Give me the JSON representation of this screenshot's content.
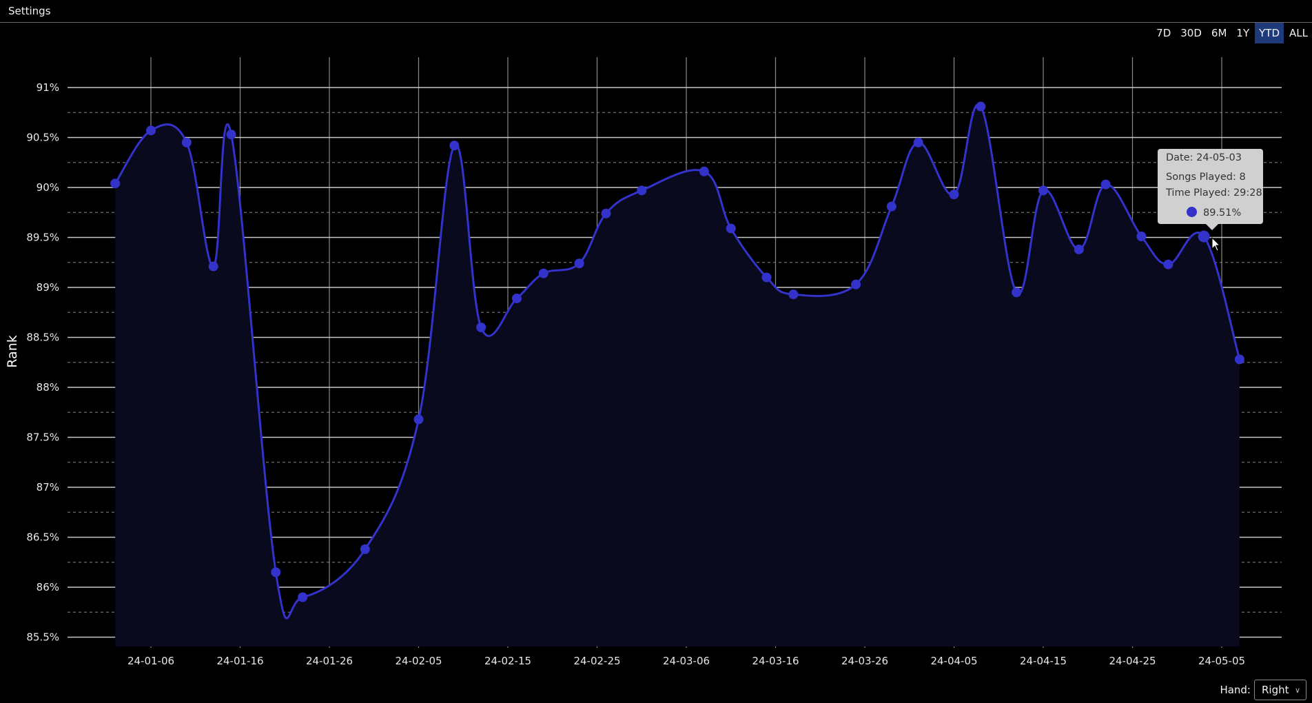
{
  "menu": {
    "settings_label": "Settings"
  },
  "range_buttons": [
    {
      "label": "7D",
      "active": false
    },
    {
      "label": "30D",
      "active": false
    },
    {
      "label": "6M",
      "active": false
    },
    {
      "label": "1Y",
      "active": false
    },
    {
      "label": "YTD",
      "active": true
    },
    {
      "label": "ALL",
      "active": false
    }
  ],
  "hand": {
    "label": "Hand:",
    "value": "Right"
  },
  "colors": {
    "series": "#3333cc",
    "fill": "#0a0a1e",
    "active_range": "#1f3a7a",
    "tooltip_bg": "#d0d0d0"
  },
  "tooltip": {
    "date_line": "Date: 24-05-03",
    "songs_line": "Songs Played: 8",
    "time_line": "Time Played: 29:28",
    "value_line": "89.51%"
  },
  "chart_data": {
    "type": "area",
    "title": "",
    "xlabel": "",
    "ylabel": "Rank",
    "ylim": [
      85.5,
      91
    ],
    "y_ticks": [
      "91%",
      "90.5%",
      "90%",
      "89.5%",
      "89%",
      "88.5%",
      "88%",
      "87.5%",
      "87%",
      "86.5%",
      "86%",
      "85.5%"
    ],
    "y_tick_values": [
      91,
      90.5,
      90,
      89.5,
      89,
      88.5,
      88,
      87.5,
      87,
      86.5,
      86,
      85.5
    ],
    "x_ticks": [
      "24-01-06",
      "24-01-16",
      "24-01-26",
      "24-02-05",
      "24-02-15",
      "24-02-25",
      "24-03-06",
      "24-03-16",
      "24-03-26",
      "24-04-05",
      "24-04-15",
      "24-04-25",
      "24-05-05"
    ],
    "x_tick_days": [
      5,
      15,
      25,
      35,
      45,
      55,
      65,
      75,
      85,
      95,
      105,
      115,
      125
    ],
    "grid": true,
    "series": [
      {
        "name": "Rank",
        "x": [
          "24-01-02",
          "24-01-06",
          "24-01-10",
          "24-01-13",
          "24-01-15",
          "24-01-20",
          "24-01-23",
          "24-01-30",
          "24-02-05",
          "24-02-09",
          "24-02-12",
          "24-02-16",
          "24-02-19",
          "24-02-23",
          "24-02-26",
          "24-03-01",
          "24-03-08",
          "24-03-11",
          "24-03-15",
          "24-03-18",
          "24-03-25",
          "24-03-29",
          "24-04-01",
          "24-04-05",
          "24-04-08",
          "24-04-12",
          "24-04-15",
          "24-04-19",
          "24-04-22",
          "24-04-26",
          "24-04-29",
          "24-05-03",
          "24-05-07"
        ],
        "days": [
          1,
          5,
          9,
          12,
          14,
          19,
          22,
          29,
          35,
          39,
          42,
          46,
          49,
          53,
          56,
          60,
          67,
          70,
          74,
          77,
          84,
          88,
          91,
          95,
          98,
          102,
          105,
          109,
          112,
          116,
          119,
          123,
          127
        ],
        "values": [
          90.04,
          90.57,
          90.45,
          89.21,
          90.53,
          86.15,
          85.9,
          86.38,
          87.68,
          90.42,
          88.6,
          88.89,
          89.14,
          89.24,
          89.74,
          89.97,
          90.16,
          89.59,
          89.1,
          88.93,
          89.03,
          89.81,
          90.45,
          89.93,
          90.81,
          88.95,
          89.97,
          89.38,
          90.03,
          89.51,
          89.23,
          89.51,
          88.28
        ]
      }
    ],
    "highlighted_point": "24-05-03"
  }
}
